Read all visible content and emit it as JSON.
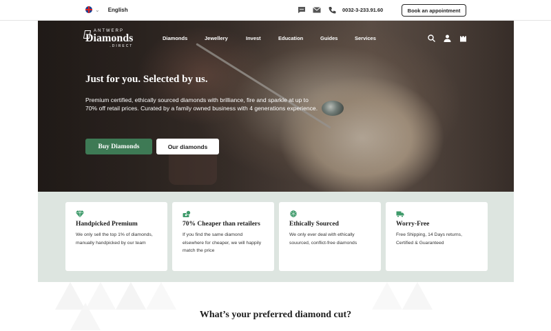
{
  "topbar": {
    "language": "English",
    "phone": "0032-3-233.91.60",
    "book_label": "Book an appointment"
  },
  "logo": {
    "top": "ANTWERP",
    "main": "Diamonds",
    "sub": ".DIRECT"
  },
  "nav": {
    "items": [
      "Diamonds",
      "Jewellery",
      "Invest",
      "Education",
      "Guides",
      "Services"
    ]
  },
  "hero": {
    "title": "Just for you. Selected by us.",
    "text": "Premium certified, ethically sourced diamonds with brilliance, fire and sparkle at up to 70% off retail prices. Curated by a family owned business with 4 generations experience.",
    "buy_label": "Buy Diamonds",
    "our_label": "Our diamonds"
  },
  "features": [
    {
      "title": "Handpicked Premium",
      "text": "We only sell the top 1% of diamonds, manually handpicked by our team",
      "icon": "diamond-icon"
    },
    {
      "title": "70% Cheaper than retailers",
      "text": "If you find the same diamond elsewhere for cheaper, we will happily match the price",
      "icon": "money-icon"
    },
    {
      "title": "Ethically Sourced",
      "text": "We only ever deal with ethically souurced, conflict-free diamonds",
      "icon": "gem-icon"
    },
    {
      "title": "Worry-Free",
      "text": "Free Shipping, 14 Days returns, Certified & Guaranteed",
      "icon": "truck-icon"
    }
  ],
  "section": {
    "title": "What’s your preferred diamond cut?"
  },
  "colors": {
    "accent": "#3e7a55",
    "features_bg": "#dde5e0"
  }
}
